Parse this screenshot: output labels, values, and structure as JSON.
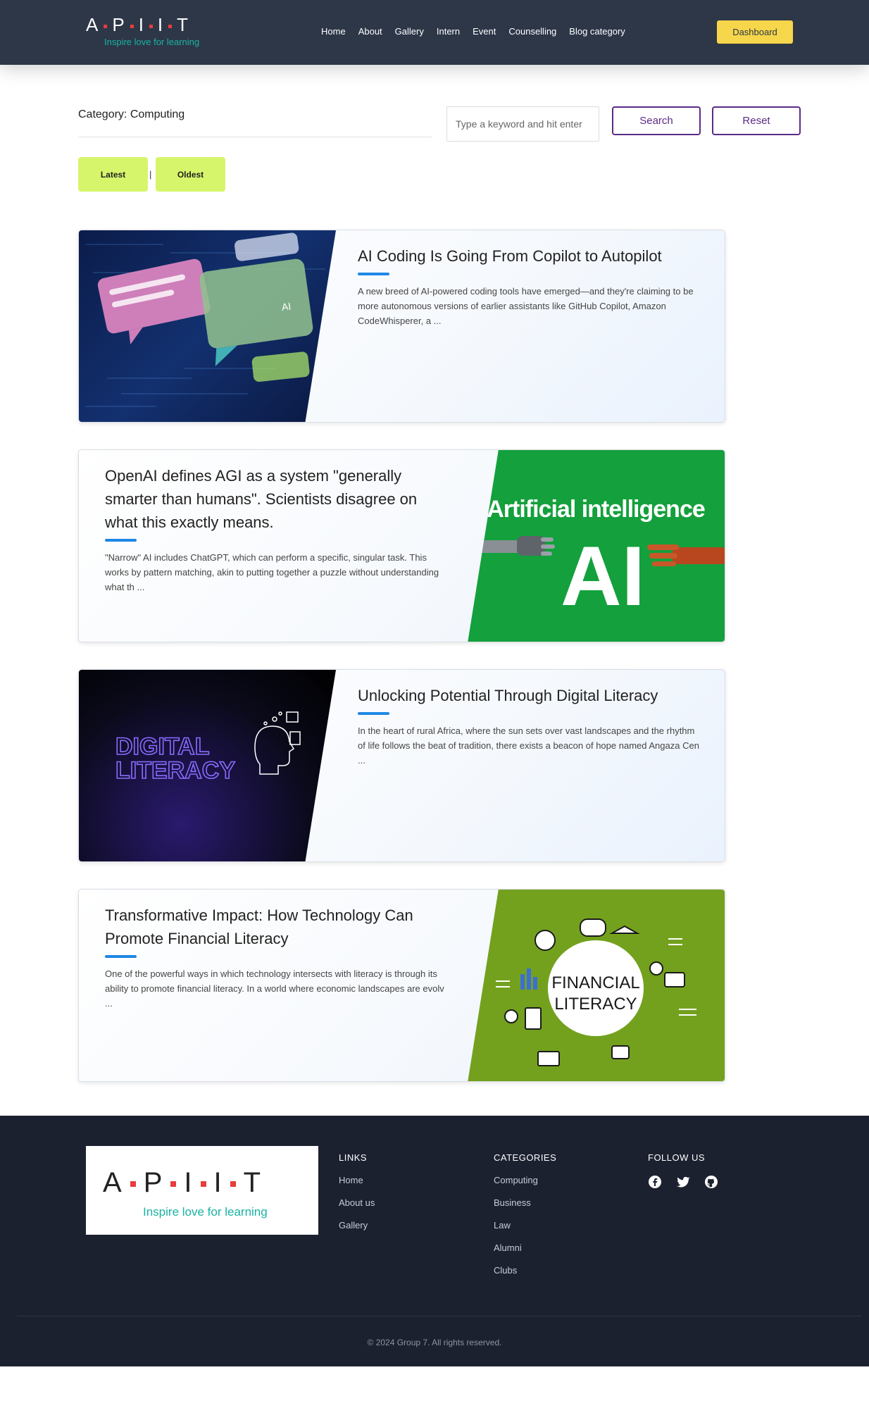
{
  "brand": {
    "logo_letters": [
      "A",
      "P",
      "I",
      "I",
      "T"
    ],
    "tagline": "Inspire love for learning",
    "accent_color": "#e53e3e",
    "tagline_color": "#19b3a3"
  },
  "nav": {
    "links": [
      "Home",
      "About",
      "Gallery",
      "Intern",
      "Event",
      "Counselling",
      "Blog category"
    ],
    "dashboard_label": "Dashboard"
  },
  "filter": {
    "category_title": "Category: Computing",
    "search_placeholder": "Type a keyword and hit enter",
    "search_label": "Search",
    "reset_label": "Reset",
    "latest_label": "Latest",
    "separator": "|",
    "oldest_label": "Oldest"
  },
  "posts": [
    {
      "title": "AI Coding Is Going From Copilot to Autopilot",
      "excerpt": "A new breed of AI-powered coding tools have emerged—and they're claiming to be more autonomous versions of earlier assistants like GitHub Copilot, Amazon CodeWhisperer, a ...",
      "image_name": "ai-coding-image"
    },
    {
      "title": "OpenAI defines AGI as a system \"generally smarter than humans\". Scientists disagree on what this exactly means.",
      "excerpt": "\"Narrow\" AI includes ChatGPT, which can perform a specific, singular task. This works by pattern matching, akin to putting together a puzzle without understanding what th ...",
      "image_name": "artificial-intelligence-image",
      "image_text_top": "Artificial intelligence",
      "image_text_big": "AI"
    },
    {
      "title": "Unlocking Potential Through Digital Literacy",
      "excerpt": "In the heart of rural Africa, where the sun sets over vast landscapes and the rhythm of life follows the beat of tradition, there exists a beacon of hope named Angaza Cen ...",
      "image_name": "digital-literacy-image",
      "image_text_1": "DIGITAL",
      "image_text_2": "LITERACY"
    },
    {
      "title": "Transformative Impact: How Technology Can Promote Financial Literacy",
      "excerpt": "One of the powerful ways in which technology intersects with literacy is through its ability to promote financial literacy. In a world where economic landscapes are evolv ...",
      "image_name": "financial-literacy-image",
      "image_text_1": "FINANCIAL",
      "image_text_2": "LITERACY"
    }
  ],
  "footer": {
    "links_heading": "LINKS",
    "links": [
      "Home",
      "About us",
      "Gallery"
    ],
    "categories_heading": "CATEGORIES",
    "categories": [
      "Computing",
      "Business",
      "Law",
      "Alumni",
      "Clubs"
    ],
    "follow_heading": "FOLLOW US",
    "social_icons": [
      "facebook-icon",
      "twitter-icon",
      "github-icon"
    ],
    "copyright": "© 2024 Group 7. All rights reserved."
  }
}
